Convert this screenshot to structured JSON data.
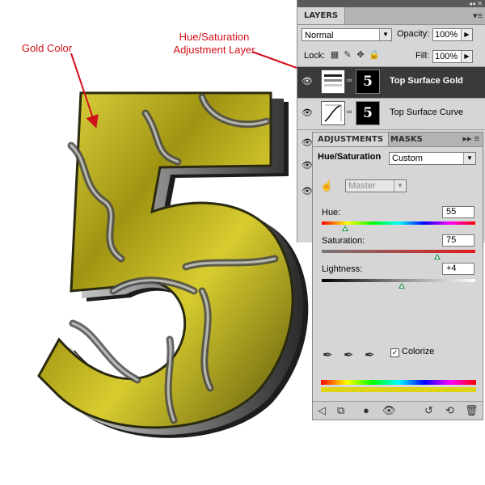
{
  "annotations": {
    "gold_color": "Gold Color",
    "hue_sat_line1": "Hue/Saturation",
    "hue_sat_line2": "Adjustment Layer"
  },
  "artwork": {
    "icon": "number-five-artwork",
    "accent_gold": "#b8aa12",
    "accent_dark": "#2b2a10"
  },
  "layers_panel": {
    "tab": "LAYERS",
    "blend_mode": "Normal",
    "opacity_label": "Opacity:",
    "opacity_value": "100%",
    "lock_label": "Lock:",
    "fill_label": "Fill:",
    "fill_value": "100%",
    "layers": [
      {
        "name": "Top Surface Gold",
        "selected": true
      },
      {
        "name": "Top Surface Curve",
        "selected": false
      }
    ]
  },
  "adjustments_panel": {
    "tab_adjustments": "ADJUSTMENTS",
    "tab_masks": "MASKS",
    "title": "Hue/Saturation",
    "preset": "Custom",
    "channel": "Master",
    "hue_label": "Hue:",
    "hue_value": "55",
    "saturation_label": "Saturation:",
    "saturation_value": "75",
    "lightness_label": "Lightness:",
    "lightness_value": "+4",
    "colorize_label": "Colorize",
    "colorize_checked": true
  },
  "colors": {
    "annotation_red": "#d0101a",
    "selected_layer": "#3a3a3a",
    "slider_thumb": "#1a8f4a"
  }
}
